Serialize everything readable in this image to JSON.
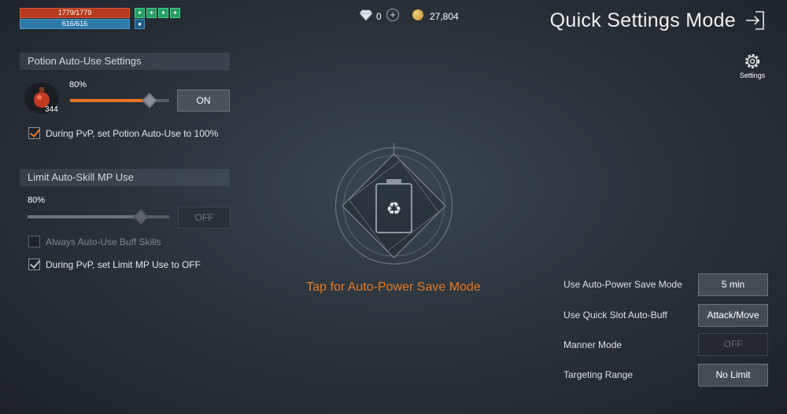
{
  "hud": {
    "hp": "1779/1779",
    "mp": "616/616",
    "buff_icons": [
      "buff-icon-1",
      "buff-icon-2",
      "buff-icon-3",
      "buff-icon-4"
    ],
    "status_icon": "paw-icon"
  },
  "currency": {
    "gems": "0",
    "gold": "27,804"
  },
  "header": {
    "title": "Quick Settings Mode",
    "settings_label": "Settings"
  },
  "potion": {
    "section_title": "Potion Auto-Use Settings",
    "percent_label": "80%",
    "percent_value": 80,
    "potion_count": "344",
    "toggle_label": "ON",
    "pvp_label": "During PvP, set Potion Auto-Use to 100%",
    "pvp_checked": true
  },
  "mp_limit": {
    "section_title": "Limit Auto-Skill MP Use",
    "percent_label": "80%",
    "percent_value": 80,
    "toggle_label": "OFF",
    "buff_label": "Always Auto-Use Buff Skills",
    "buff_checked": false,
    "pvp_label": "During PvP, set Limit MP Use to OFF",
    "pvp_checked": true
  },
  "power_save": {
    "label": "Tap for Auto-Power Save Mode"
  },
  "options": [
    {
      "label": "Use Auto-Power Save Mode",
      "value": "5 min",
      "enabled": true
    },
    {
      "label": "Use Quick Slot Auto-Buff",
      "value": "Attack/Move",
      "enabled": true
    },
    {
      "label": "Manner Mode",
      "value": "OFF",
      "enabled": false
    },
    {
      "label": "Targeting Range",
      "value": "No Limit",
      "enabled": true
    }
  ],
  "colors": {
    "accent": "#e87722",
    "hp_bar": "#b33b1f",
    "mp_bar": "#2f79a8"
  }
}
